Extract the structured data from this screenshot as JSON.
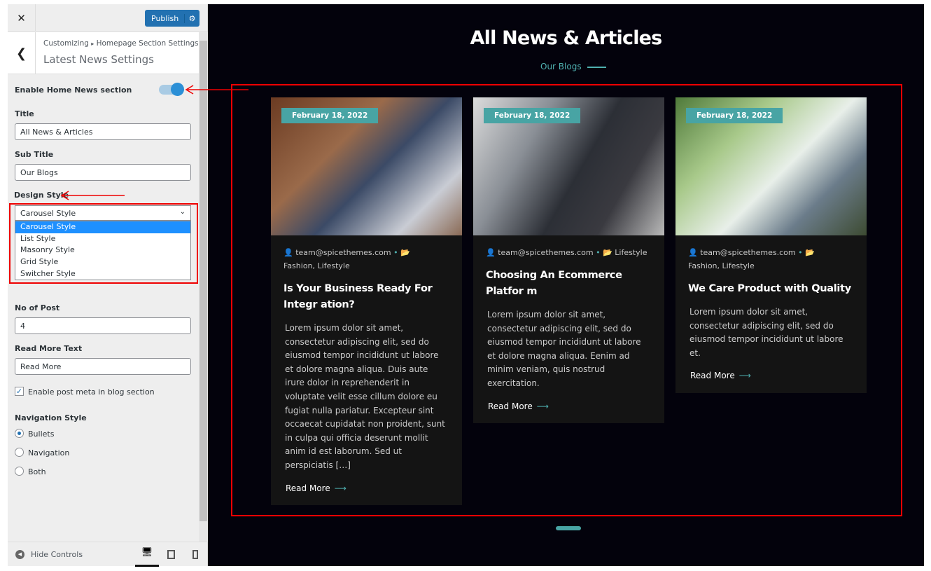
{
  "sidebar": {
    "publish": "Publish",
    "breadcrumb": {
      "root": "Customizing",
      "sep": "▸",
      "parent": "Homepage Section Settings",
      "title": "Latest News Settings"
    },
    "enable_label": "Enable Home News section",
    "enable_on": true,
    "title_label": "Title",
    "title_value": "All News & Articles",
    "subtitle_label": "Sub Title",
    "subtitle_value": "Our Blogs",
    "design_label": "Design Style",
    "design_value": "Carousel Style",
    "design_options": [
      "Carousel Style",
      "List Style",
      "Masonry Style",
      "Grid Style",
      "Switcher Style"
    ],
    "posts_label": "No of Post",
    "posts_value": "4",
    "readmore_label": "Read More Text",
    "readmore_value": "Read More",
    "meta_checkbox": "Enable post meta in blog section",
    "meta_checked": true,
    "nav_label": "Navigation Style",
    "nav_options": [
      "Bullets",
      "Navigation",
      "Both"
    ],
    "nav_selected": "Bullets",
    "hide_controls": "Hide Controls"
  },
  "preview": {
    "heading": "All News & Articles",
    "subheading": "Our Blogs",
    "accent": "#48a4a4",
    "posts": [
      {
        "date": "February 18, 2022",
        "author": "team@spicethemes.com",
        "categories": "Fashion, Lifestyle",
        "title": "Is Your Business Ready For Integr ation?",
        "excerpt": "Lorem ipsum dolor sit amet, consectetur adipiscing elit, sed do eiusmod tempor incididunt ut labore et dolore magna aliqua. Duis aute irure dolor in reprehenderit in voluptate velit esse cillum dolore eu fugiat nulla pariatur. Excepteur sint occaecat cupidatat non proident, sunt in culpa qui officia deserunt mollit anim id est laborum. Sed ut perspiciatis […]",
        "read_more": "Read More"
      },
      {
        "date": "February 18, 2022",
        "author": "team@spicethemes.com",
        "categories": "Lifestyle",
        "title": "Choosing An Ecommerce Platfor m",
        "excerpt": "Lorem ipsum dolor sit amet, consectetur adipiscing elit, sed do eiusmod tempor incididunt ut labore et dolore magna aliqua. Eenim ad minim veniam, quis nostrud exercitation.",
        "read_more": "Read More"
      },
      {
        "date": "February 18, 2022",
        "author": "team@spicethemes.com",
        "categories": "Fashion, Lifestyle",
        "title": "We Care Product with Quality",
        "excerpt": "Lorem ipsum dolor sit amet, consectetur adipiscing elit, sed do eiusmod tempor incididunt ut labore et.",
        "read_more": "Read More"
      }
    ]
  }
}
